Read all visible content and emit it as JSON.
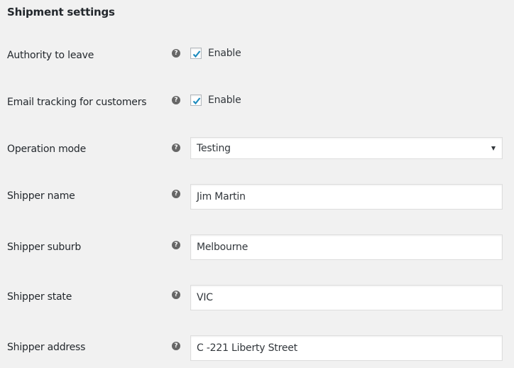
{
  "section_title": "Shipment settings",
  "colors": {
    "background": "#f1f1f1",
    "checkmark": "#1e8cbe",
    "help_icon": "#666666",
    "input_border": "#dddddd"
  },
  "help_icon_glyph": "?",
  "fields": {
    "authority_to_leave": {
      "label": "Authority to leave",
      "checkbox_label": "Enable",
      "checked": true
    },
    "email_tracking": {
      "label": "Email tracking for customers",
      "checkbox_label": "Enable",
      "checked": true
    },
    "operation_mode": {
      "label": "Operation mode",
      "selected": "Testing"
    },
    "shipper_name": {
      "label": "Shipper name",
      "value": "Jim Martin"
    },
    "shipper_suburb": {
      "label": "Shipper suburb",
      "value": "Melbourne"
    },
    "shipper_state": {
      "label": "Shipper state",
      "value": "VIC"
    },
    "shipper_address": {
      "label": "Shipper address",
      "value": "C -221 Liberty Street"
    }
  }
}
